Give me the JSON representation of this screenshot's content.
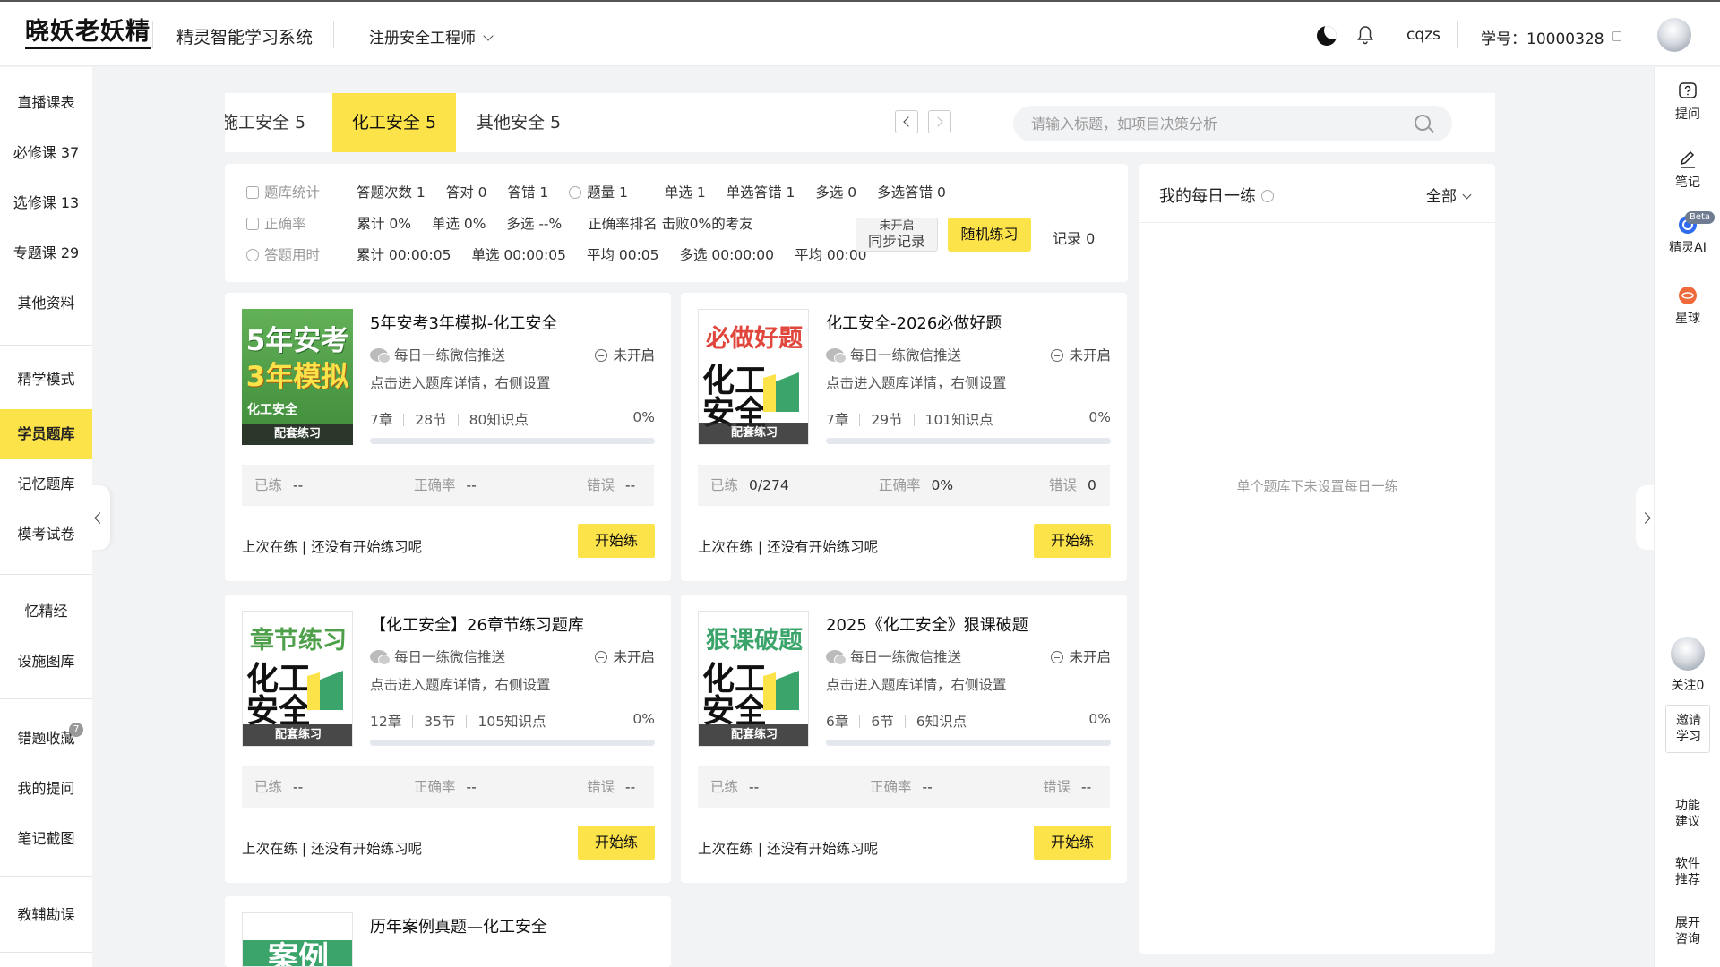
{
  "header": {
    "logo": "晓妖老妖精",
    "system_name": "精灵智能学习系统",
    "course": "注册安全工程师",
    "username": "cqzs",
    "student_id": "学号：10000328"
  },
  "left_nav": {
    "items": [
      {
        "label": "直播课表"
      },
      {
        "label": "必修课 37"
      },
      {
        "label": "选修课 13"
      },
      {
        "label": "专题课 29"
      },
      {
        "label": "其他资料"
      },
      {
        "label": "精学模式"
      },
      {
        "label": "学员题库"
      },
      {
        "label": "记忆题库"
      },
      {
        "label": "模考试卷"
      },
      {
        "label": "忆精经"
      },
      {
        "label": "设施图库"
      },
      {
        "label": "错题收藏",
        "badge": "7"
      },
      {
        "label": "我的提问"
      },
      {
        "label": "笔记截图"
      },
      {
        "label": "教辅勘误"
      }
    ],
    "active_index": 6
  },
  "tabs": {
    "items": [
      {
        "label": "施工安全 5"
      },
      {
        "label": "化工安全 5"
      },
      {
        "label": "其他安全 5"
      }
    ],
    "active_index": 1,
    "search_placeholder": "请输入标题，如项目决策分析"
  },
  "stats": {
    "row1": {
      "label": "题库统计",
      "items": [
        "答题次数 1",
        "答对 0",
        "答错 1"
      ],
      "label2": "题量 1",
      "items2": [
        "单选 1",
        "单选答错 1",
        "多选 0",
        "多选答错 0"
      ]
    },
    "row2": {
      "label": "正确率",
      "items": [
        "累计 0%",
        "单选 0%",
        "多选 --%",
        "正确率排名 击败0%的考友"
      ]
    },
    "row3": {
      "label": "答题用时",
      "items": [
        "累计 00:00:05",
        "单选 00:00:05",
        "平均 00:05",
        "多选 00:00:00",
        "平均 00:00"
      ]
    },
    "sync_status": "未开启",
    "sync_label": "同步记录",
    "random_label": "随机练习",
    "records": "记录 0"
  },
  "daily": {
    "title": "我的每日一练",
    "filter": "全部",
    "empty_text": "单个题库下未设置每日一练"
  },
  "cards": [
    {
      "title": "5年安考3年模拟-化工安全",
      "cover_line1": "5年安考",
      "cover_line2": "3年模拟",
      "cover_sub": "化工安全",
      "cover_tag": "配套练习",
      "wechat": "每日一练微信推送",
      "state": "未开启",
      "hint": "点击进入题库详情，右侧设置",
      "chapters": "7章",
      "sections": "28节",
      "points": "80知识点",
      "progress": "0%",
      "done_label": "已练",
      "done": "--",
      "acc_label": "正确率",
      "acc": "--",
      "err_label": "错误",
      "err": "--",
      "last": "上次在练 | 还没有开始练习呢",
      "btn": "开始练"
    },
    {
      "title": "化工安全-2026必做好题",
      "cover_line1": "必做好题",
      "cover_line2": "化工",
      "cover_line3": "安全",
      "cover_tag": "配套练习",
      "wechat": "每日一练微信推送",
      "state": "未开启",
      "hint": "点击进入题库详情，右侧设置",
      "chapters": "7章",
      "sections": "29节",
      "points": "101知识点",
      "progress": "0%",
      "done_label": "已练",
      "done": "0/274",
      "acc_label": "正确率",
      "acc": "0%",
      "err_label": "错误",
      "err": "0",
      "last": "上次在练 | 还没有开始练习呢",
      "btn": "开始练"
    },
    {
      "title": "【化工安全】26章节练习题库",
      "cover_line1": "章节练习",
      "cover_line2": "化工",
      "cover_line3": "安全",
      "cover_tag": "配套练习",
      "wechat": "每日一练微信推送",
      "state": "未开启",
      "hint": "点击进入题库详情，右侧设置",
      "chapters": "12章",
      "sections": "35节",
      "points": "105知识点",
      "progress": "0%",
      "done_label": "已练",
      "done": "--",
      "acc_label": "正确率",
      "acc": "--",
      "err_label": "错误",
      "err": "--",
      "last": "上次在练 | 还没有开始练习呢",
      "btn": "开始练"
    },
    {
      "title": "2025《化工安全》狠课破题",
      "cover_line1": "狠课破题",
      "cover_line2": "化工",
      "cover_line3": "安全",
      "cover_tag": "配套练习",
      "wechat": "每日一练微信推送",
      "state": "未开启",
      "hint": "点击进入题库详情，右侧设置",
      "chapters": "6章",
      "sections": "6节",
      "points": "6知识点",
      "progress": "0%",
      "done_label": "已练",
      "done": "--",
      "acc_label": "正确率",
      "acc": "--",
      "err_label": "错误",
      "err": "--",
      "last": "上次在练 | 还没有开始练习呢",
      "btn": "开始练"
    },
    {
      "title": "历年案例真题—化工安全",
      "cover_line1": "案例"
    }
  ],
  "right_bar": {
    "ask": "提问",
    "notes": "笔记",
    "ai": "精灵AI",
    "ai_badge": "Beta",
    "planet": "星球",
    "follow": "关注0",
    "invite": [
      "邀请",
      "学习"
    ],
    "feedback": [
      "功能",
      "建议"
    ],
    "software": [
      "软件",
      "推荐"
    ],
    "consult": [
      "展开",
      "咨询"
    ]
  },
  "colors": {
    "accent": "#fce34a",
    "cover_green": "#4fa04a",
    "cover_red": "#e0463c",
    "cover_teal": "#3aa46a"
  }
}
